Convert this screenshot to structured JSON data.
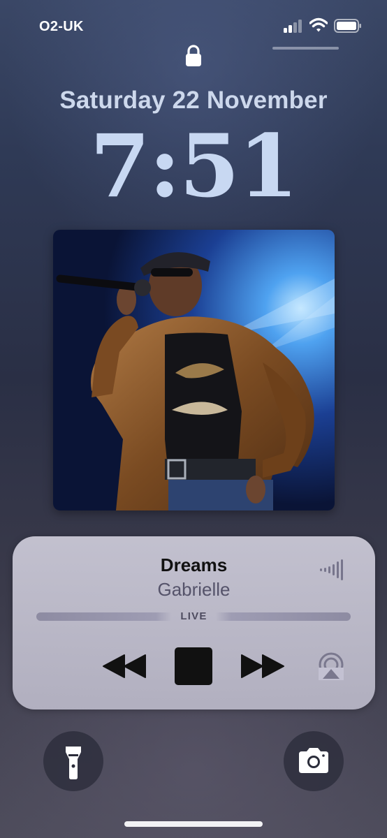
{
  "status_bar": {
    "carrier": "O2-UK",
    "signal_bars_filled": 2,
    "signal_bars_total": 4,
    "icons": [
      "signal-icon",
      "wifi-icon",
      "battery-icon"
    ]
  },
  "lock_screen": {
    "lock_icon": "lock-icon",
    "date": "Saturday 22 November",
    "time": "7:51"
  },
  "now_playing": {
    "artwork": "album-artwork",
    "title": "Dreams",
    "artist": "Gabrielle",
    "progress_label": "LIVE",
    "controls": [
      "rewind-icon",
      "stop-icon",
      "fast-forward-icon",
      "airplay-icon"
    ],
    "waveform_icon": "waveform-icon"
  },
  "quick_actions": {
    "left": "flashlight-icon",
    "right": "camera-icon"
  },
  "colors": {
    "date_time_text": "#c8d8f2",
    "player_card": "#c8c6d6",
    "control_black": "#111111"
  }
}
